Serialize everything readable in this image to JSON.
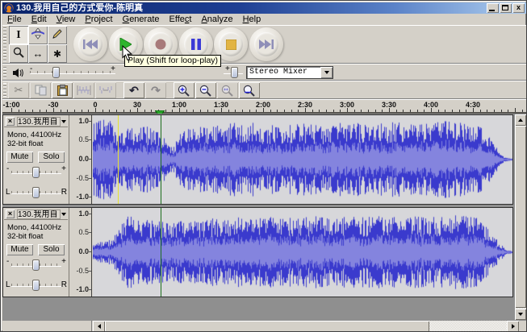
{
  "window": {
    "title": "130.我用自己的方式爱你-陈明真",
    "controls": [
      "minimize",
      "maximize",
      "close"
    ],
    "close_glyph": "x"
  },
  "menu": {
    "items": [
      {
        "label": "File",
        "accel": 0
      },
      {
        "label": "Edit",
        "accel": 0
      },
      {
        "label": "View",
        "accel": 0
      },
      {
        "label": "Project",
        "accel": 0
      },
      {
        "label": "Generate",
        "accel": 0
      },
      {
        "label": "Effect",
        "accel": 4
      },
      {
        "label": "Analyze",
        "accel": 0
      },
      {
        "label": "Help",
        "accel": 0
      }
    ]
  },
  "tools": [
    {
      "name": "selection-tool",
      "selected": true
    },
    {
      "name": "envelope-tool",
      "selected": false
    },
    {
      "name": "draw-tool",
      "selected": false
    },
    {
      "name": "zoom-tool",
      "selected": false
    },
    {
      "name": "time-shift-tool",
      "selected": false
    },
    {
      "name": "multi-tool",
      "selected": false
    }
  ],
  "transport": {
    "buttons": [
      {
        "name": "skip-to-start"
      },
      {
        "name": "play"
      },
      {
        "name": "record"
      },
      {
        "name": "pause"
      },
      {
        "name": "stop"
      },
      {
        "name": "skip-to-end"
      }
    ],
    "colors": {
      "play": "#2eb52e",
      "record": "#a87a7a",
      "pause": "#3a3ad6",
      "stop": "#e2b442",
      "skip": "#8f8fb8"
    }
  },
  "tooltip": {
    "text": "Play (Shift for loop-play)"
  },
  "mixer": {
    "output_min": "-",
    "output_max": "+",
    "input_max": "+",
    "device": "Stereo Mixer"
  },
  "edit_toolbar": {
    "buttons": [
      {
        "name": "cut",
        "disabled": true
      },
      {
        "name": "copy",
        "disabled": true
      },
      {
        "name": "paste",
        "disabled": false
      },
      {
        "name": "trim-outside-selection",
        "disabled": true
      },
      {
        "name": "silence-selection",
        "disabled": true
      },
      {
        "name": "undo",
        "disabled": false
      },
      {
        "name": "redo",
        "disabled": true
      },
      {
        "name": "zoom-in",
        "disabled": false
      },
      {
        "name": "zoom-out",
        "disabled": false
      },
      {
        "name": "fit-selection",
        "disabled": true
      },
      {
        "name": "fit-project",
        "disabled": false
      }
    ]
  },
  "ruler": {
    "labels": [
      "-1:00",
      "-30",
      "0",
      "30",
      "1:00",
      "1:30",
      "2:00",
      "2:30",
      "3:00",
      "3:30",
      "4:00",
      "4:30"
    ],
    "start_x": 11,
    "spacing": 52,
    "playhead_x": 195
  },
  "tracks": [
    {
      "name": "130.我用自",
      "format": "Mono, 44100Hz",
      "depth": "32-bit float",
      "mute_label": "Mute",
      "solo_label": "Solo",
      "gain_min": "-",
      "gain_max": "+",
      "pan_left": "L",
      "pan_right": "R",
      "yticks": [
        "1.0",
        "0.5",
        "0.0",
        "-0.5",
        "-1.0"
      ]
    },
    {
      "name": "130.我用自",
      "format": "Mono, 44100Hz",
      "depth": "32-bit float",
      "mute_label": "Mute",
      "solo_label": "Solo",
      "gain_min": "-",
      "gain_max": "+",
      "pan_left": "L",
      "pan_right": "R",
      "yticks": [
        "1.0",
        "0.5",
        "0.0",
        "-0.5",
        "-1.0"
      ]
    }
  ],
  "waveform": {
    "wave_color": "#3a3acd",
    "rms_color": "#8484de",
    "background": "#d7d7da",
    "cursors": [
      {
        "x": 143,
        "color": "#e6e330",
        "tracks": [
          0
        ]
      },
      {
        "x": 196,
        "color": "#1c6e1c",
        "tracks": [
          0,
          1
        ]
      }
    ],
    "seeds": [
      1234,
      5678
    ],
    "envelopes": [
      [
        [
          0,
          0.85
        ],
        [
          0.04,
          0.95
        ],
        [
          0.055,
          0.55
        ],
        [
          0.08,
          0.72
        ],
        [
          0.12,
          0.8
        ],
        [
          0.16,
          0.6
        ],
        [
          0.19,
          0.25
        ],
        [
          0.205,
          0.55
        ],
        [
          0.22,
          0.72
        ],
        [
          0.3,
          0.78
        ],
        [
          0.36,
          0.88
        ],
        [
          0.42,
          0.78
        ],
        [
          0.48,
          0.85
        ],
        [
          0.54,
          0.78
        ],
        [
          0.6,
          0.88
        ],
        [
          0.66,
          0.8
        ],
        [
          0.72,
          0.86
        ],
        [
          0.78,
          0.8
        ],
        [
          0.84,
          0.88
        ],
        [
          0.9,
          0.82
        ],
        [
          0.93,
          0.75
        ],
        [
          0.955,
          0.45
        ],
        [
          0.97,
          0.15
        ],
        [
          0.985,
          0.04
        ],
        [
          1,
          0.02
        ]
      ],
      [
        [
          0,
          0.22
        ],
        [
          0.04,
          0.28
        ],
        [
          0.06,
          0.5
        ],
        [
          0.075,
          0.85
        ],
        [
          0.12,
          0.75
        ],
        [
          0.18,
          0.68
        ],
        [
          0.25,
          0.75
        ],
        [
          0.32,
          0.8
        ],
        [
          0.4,
          0.85
        ],
        [
          0.48,
          0.78
        ],
        [
          0.56,
          0.85
        ],
        [
          0.64,
          0.8
        ],
        [
          0.72,
          0.85
        ],
        [
          0.8,
          0.8
        ],
        [
          0.87,
          0.85
        ],
        [
          0.92,
          0.78
        ],
        [
          0.95,
          0.5
        ],
        [
          0.97,
          0.2
        ],
        [
          0.99,
          0.05
        ],
        [
          1,
          0.02
        ]
      ]
    ]
  }
}
